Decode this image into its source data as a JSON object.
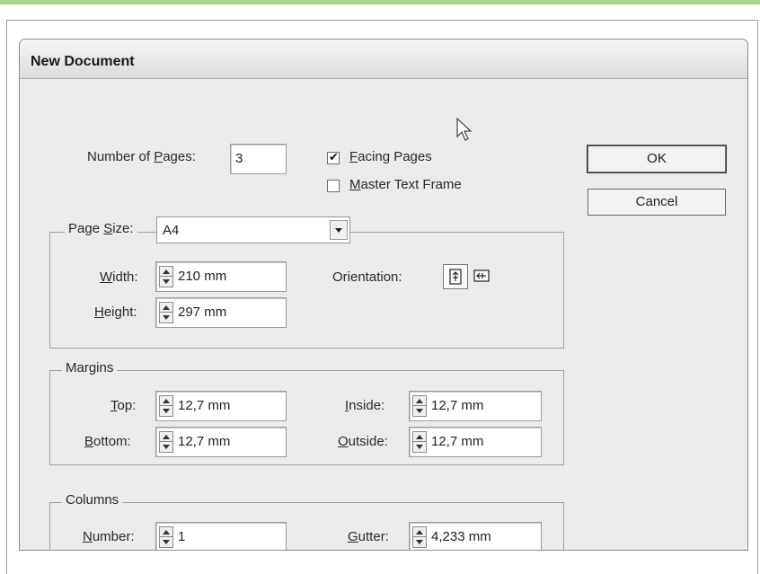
{
  "dialog": {
    "title": "New Document",
    "number_of_pages": {
      "label_pre": "Number of ",
      "label_u": "P",
      "label_post": "ages:",
      "value": "3"
    },
    "facing_pages": {
      "checked": true,
      "label_u": "F",
      "label_post": "acing Pages"
    },
    "master_text_frame": {
      "checked": false,
      "label_u": "M",
      "label_post": "aster Text Frame"
    },
    "buttons": {
      "ok": "OK",
      "cancel": "Cancel"
    },
    "page_size": {
      "label_pre": "Page ",
      "label_u": "S",
      "label_post": "ize:",
      "selected": "A4",
      "width": {
        "label_u": "W",
        "label_post": "idth:",
        "value": "210 mm"
      },
      "height": {
        "label_u": "H",
        "label_post": "eight:",
        "value": "297 mm"
      },
      "orientation": {
        "label": "Orientation:",
        "options": [
          "portrait-icon",
          "landscape-icon"
        ],
        "selected": "portrait"
      }
    },
    "margins": {
      "title": "Margins",
      "top": {
        "label_u": "T",
        "label_post": "op:",
        "value": "12,7 mm"
      },
      "bottom": {
        "label_u": "B",
        "label_post": "ottom:",
        "value": "12,7 mm"
      },
      "inside": {
        "label_u": "I",
        "label_post": "nside:",
        "value": "12,7 mm"
      },
      "outside": {
        "label_u": "O",
        "label_post": "utside:",
        "value": "12,7 mm"
      }
    },
    "columns": {
      "title": "Columns",
      "number": {
        "label_u": "N",
        "label_post": "umber:",
        "value": "1"
      },
      "gutter": {
        "label_u": "G",
        "label_post": "utter:",
        "value": "4,233 mm"
      }
    }
  },
  "colors": {
    "accent_bar": "#a8d48c",
    "dialog_bg": "#ebebeb"
  }
}
